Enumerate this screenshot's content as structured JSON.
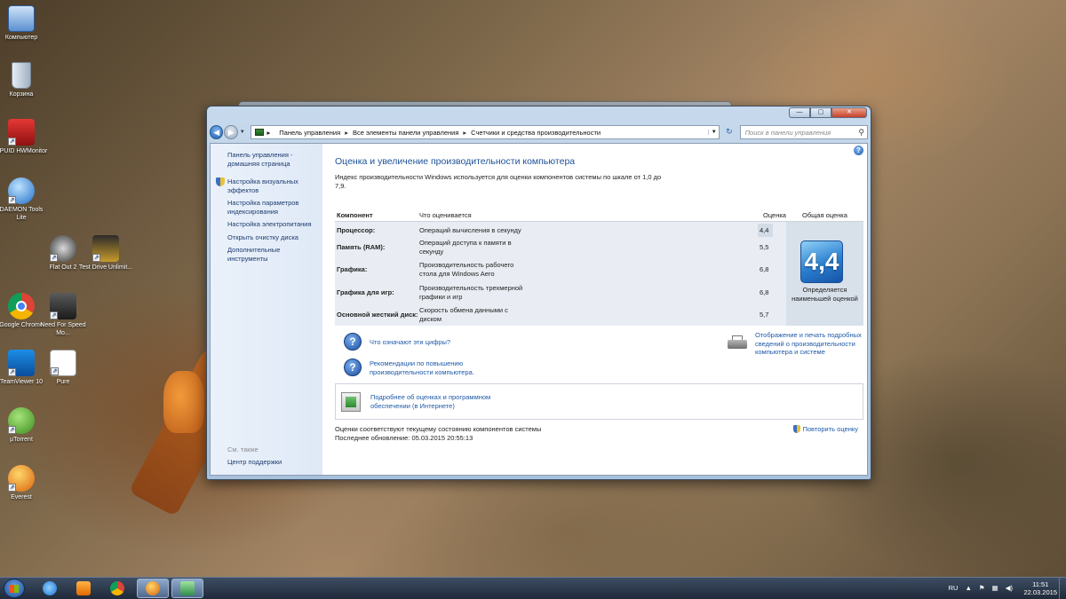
{
  "desktop": {
    "icons": [
      {
        "label": "Компьютер",
        "icon": "computer-icon"
      },
      {
        "label": "Корзина",
        "icon": "recycle-bin-icon"
      },
      {
        "label": "CPUID HWMonitor",
        "icon": "hwmonitor-icon"
      },
      {
        "label": "DAEMON Tools Lite",
        "icon": "daemon-tools-icon"
      },
      {
        "label": "Flat Out 2",
        "icon": "game-icon"
      },
      {
        "label": "Test Drive Unlimit...",
        "icon": "game-icon"
      },
      {
        "label": "Google Chrome",
        "icon": "chrome-icon"
      },
      {
        "label": "Need For Speed Mo...",
        "icon": "game-icon"
      },
      {
        "label": "TeamViewer 10",
        "icon": "teamviewer-icon"
      },
      {
        "label": "Pure",
        "icon": "game-icon"
      },
      {
        "label": "µTorrent",
        "icon": "utorrent-icon"
      },
      {
        "label": "Everest",
        "icon": "everest-icon"
      }
    ]
  },
  "window": {
    "controls": {
      "minimize": "—",
      "maximize": "▢",
      "close": "✕"
    },
    "breadcrumb": [
      "Панель управления",
      "Все элементы панели управления",
      "Счетчики и средства производительности"
    ],
    "search_placeholder": "Поиск в панели управления",
    "left_nav": {
      "items": [
        {
          "label": "Панель управления - домашняя страница"
        },
        {
          "label": "Настройка визуальных эффектов"
        },
        {
          "label": "Настройка параметров индексирования"
        },
        {
          "label": "Настройка электропитания"
        },
        {
          "label": "Открыть очистку диска"
        },
        {
          "label": "Дополнительные инструменты"
        }
      ],
      "see_also": "См. также",
      "support": "Центр поддержки"
    },
    "main": {
      "title": "Оценка и увеличение производительности компьютера",
      "intro": "Индекс производительности Windows используется для оценки компонентов системы по шкале от 1,0 до 7,9.",
      "table": {
        "headers": {
          "component": "Компонент",
          "what": "Что оценивается",
          "score": "Оценка",
          "overall": "Общая оценка"
        },
        "rows": [
          {
            "component": "Процессор:",
            "what": "Операций вычисления в секунду",
            "score": "4,4"
          },
          {
            "component": "Память (RAM):",
            "what": "Операций доступа к памяти в секунду",
            "score": "5,5"
          },
          {
            "component": "Графика:",
            "what": "Производительность рабочего стола для Windows Aero",
            "score": "6,8"
          },
          {
            "component": "Графика для игр:",
            "what": "Производительность трехмерной графики и игр",
            "score": "6,8"
          },
          {
            "component": "Основной жесткий диск:",
            "what": "Скорость обмена данными с диском",
            "score": "5,7"
          }
        ],
        "overall_score": "4,4",
        "overall_caption": "Определяется наименьшей оценкой"
      },
      "links": {
        "what_mean": "Что означают эти цифры?",
        "tips": "Рекомендации по повышению производительности компьютера.",
        "print": "Отображение и печать подробных сведений о производительности компьютера и системе",
        "online": "Подробнее об оценках и программном обеспечении (в Интернете)"
      },
      "status_line1": "Оценки соответствуют текущему состоянию компонентов системы",
      "status_line2": "Последнее обновление: 05.03.2015 20:55:13",
      "rerun": "Повторить оценку"
    }
  },
  "taskbar": {
    "lang": "RU",
    "time": "11:51",
    "date": "22.03.2015"
  }
}
